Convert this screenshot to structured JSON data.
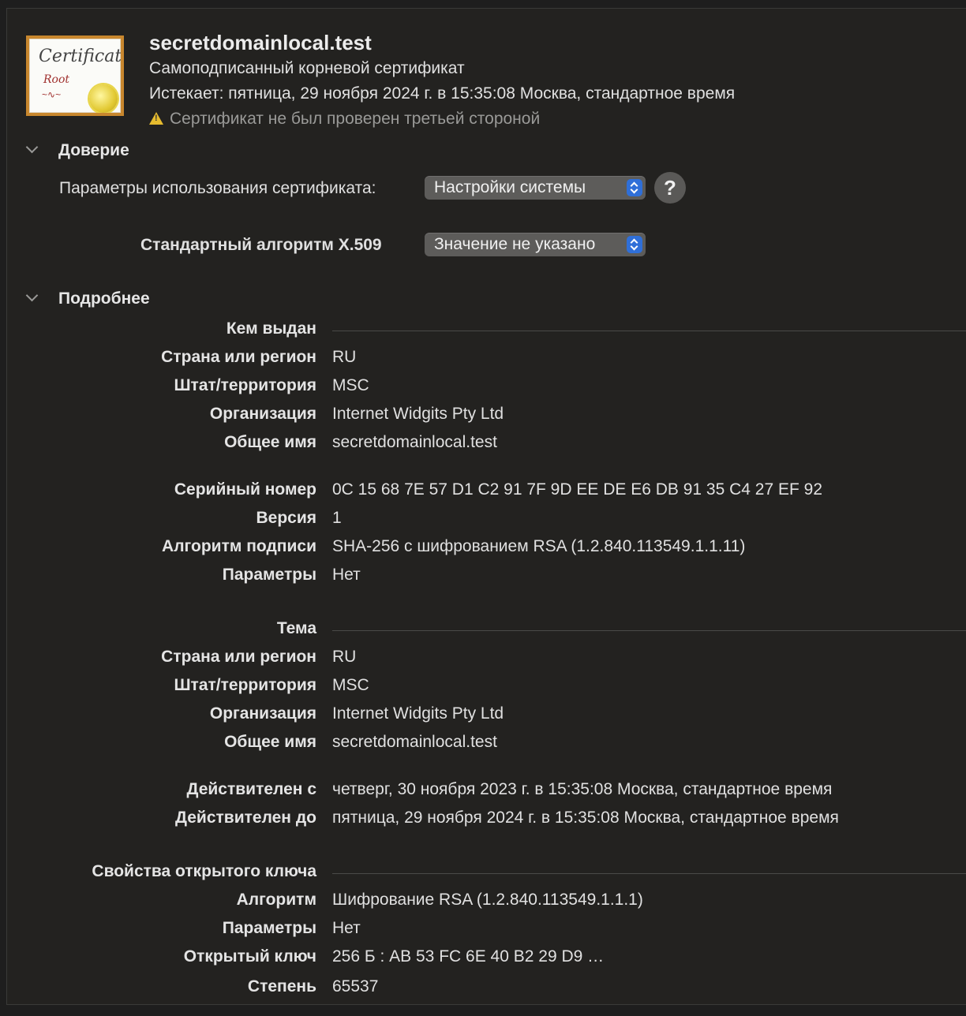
{
  "header": {
    "title": "secretdomainlocal.test",
    "subtitle": "Самоподписанный корневой сертификат",
    "expires": "Истекает: пятница, 29 ноября 2024 г. в 15:35:08 Москва, стандартное время",
    "warning": "Сертификат не был проверен третьей стороной",
    "icon_text_1": "Certificate",
    "icon_text_2": "Root"
  },
  "trust": {
    "section_label": "Доверие",
    "usage_label": "Параметры использования сертификата:",
    "usage_value": "Настройки системы",
    "x509_label": "Стандартный алгоритм X.509",
    "x509_value": "Значение не указано",
    "help_label": "?"
  },
  "details": {
    "section_label": "Подробнее",
    "issuer": {
      "heading": "Кем выдан",
      "rows": [
        {
          "k": "Страна или регион",
          "v": "RU"
        },
        {
          "k": "Штат/территория",
          "v": "MSC"
        },
        {
          "k": "Организация",
          "v": "Internet Widgits Pty Ltd"
        },
        {
          "k": "Общее имя",
          "v": "secretdomainlocal.test"
        }
      ]
    },
    "info": [
      {
        "k": "Серийный номер",
        "v": "0C 15 68 7E 57 D1 C2 91 7F 9D EE DE E6 DB 91 35 C4 27 EF 92"
      },
      {
        "k": "Версия",
        "v": "1"
      },
      {
        "k": "Алгоритм подписи",
        "v": "SHA-256 с шифрованием RSA (1.2.840.113549.1.1.11)"
      },
      {
        "k": "Параметры",
        "v": "Нет"
      }
    ],
    "subject": {
      "heading": "Тема",
      "rows": [
        {
          "k": "Страна или регион",
          "v": "RU"
        },
        {
          "k": "Штат/территория",
          "v": "MSC"
        },
        {
          "k": "Организация",
          "v": "Internet Widgits Pty Ltd"
        },
        {
          "k": "Общее имя",
          "v": "secretdomainlocal.test"
        }
      ]
    },
    "validity": [
      {
        "k": "Действителен с",
        "v": "четверг, 30 ноября 2023 г. в 15:35:08 Москва, стандартное время"
      },
      {
        "k": "Действителен до",
        "v": "пятница, 29 ноября 2024 г. в 15:35:08 Москва, стандартное время"
      }
    ],
    "public_key": {
      "heading": "Свойства открытого ключа",
      "rows": [
        {
          "k": "Алгоритм",
          "v": "Шифрование RSA (1.2.840.113549.1.1.1)"
        },
        {
          "k": "Параметры",
          "v": "Нет"
        },
        {
          "k": "Открытый ключ",
          "v": "256 Б : AB 53 FC 6E 40 B2 29 D9 …"
        },
        {
          "k": "Степень",
          "v": "65537"
        }
      ]
    }
  }
}
